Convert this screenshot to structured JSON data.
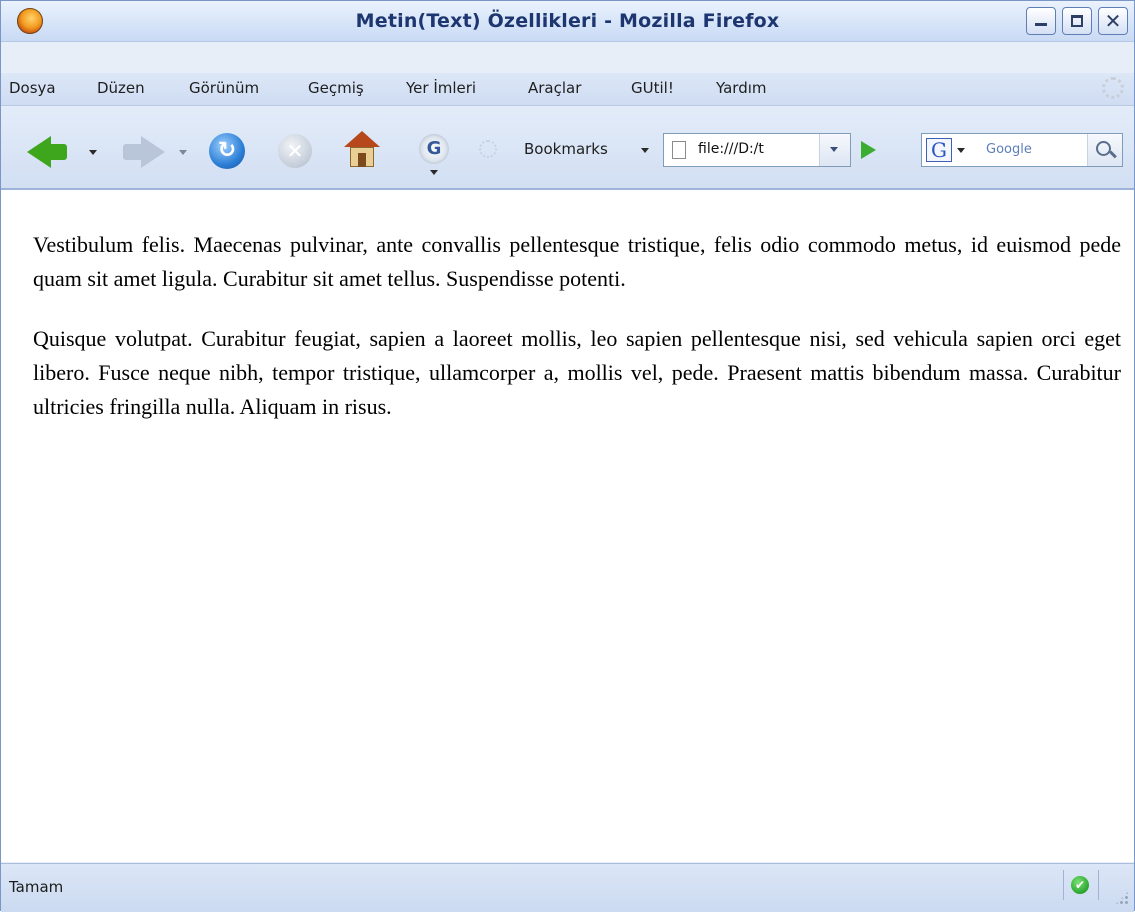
{
  "window": {
    "title": "Metin(Text) Özellikleri - Mozilla Firefox"
  },
  "menu": {
    "items": [
      "Dosya",
      "Düzen",
      "Görünüm",
      "Geçmiş",
      "Yer İmleri",
      "Araçlar",
      "GUtil!",
      "Yardım"
    ]
  },
  "toolbar": {
    "bookmarks_label": "Bookmarks",
    "address_value": "file:///D:/t",
    "search_placeholder": "Google",
    "search_engine_letter": "G",
    "icons": [
      "back-arrow-icon",
      "forward-arrow-icon",
      "reload-icon",
      "stop-icon",
      "home-icon",
      "gear-g-icon",
      "go-arrow-icon",
      "search-magnifier-icon"
    ]
  },
  "content": {
    "paragraphs": [
      "Vestibulum felis. Maecenas pulvinar, ante convallis pellentesque tristique, felis odio commodo metus, id euismod pede quam sit amet ligula. Curabitur sit amet tellus. Suspendisse potenti.",
      "Quisque volutpat. Curabitur feugiat, sapien a laoreet mollis, leo sapien pellentesque nisi, sed vehicula sapien orci eget libero. Fusce neque nibh, tempor tristique, ullamcorper a, mollis vel, pede. Praesent mattis bibendum massa. Curabitur ultricies fringilla nulla. Aliquam in risus."
    ]
  },
  "status": {
    "text": "Tamam"
  }
}
